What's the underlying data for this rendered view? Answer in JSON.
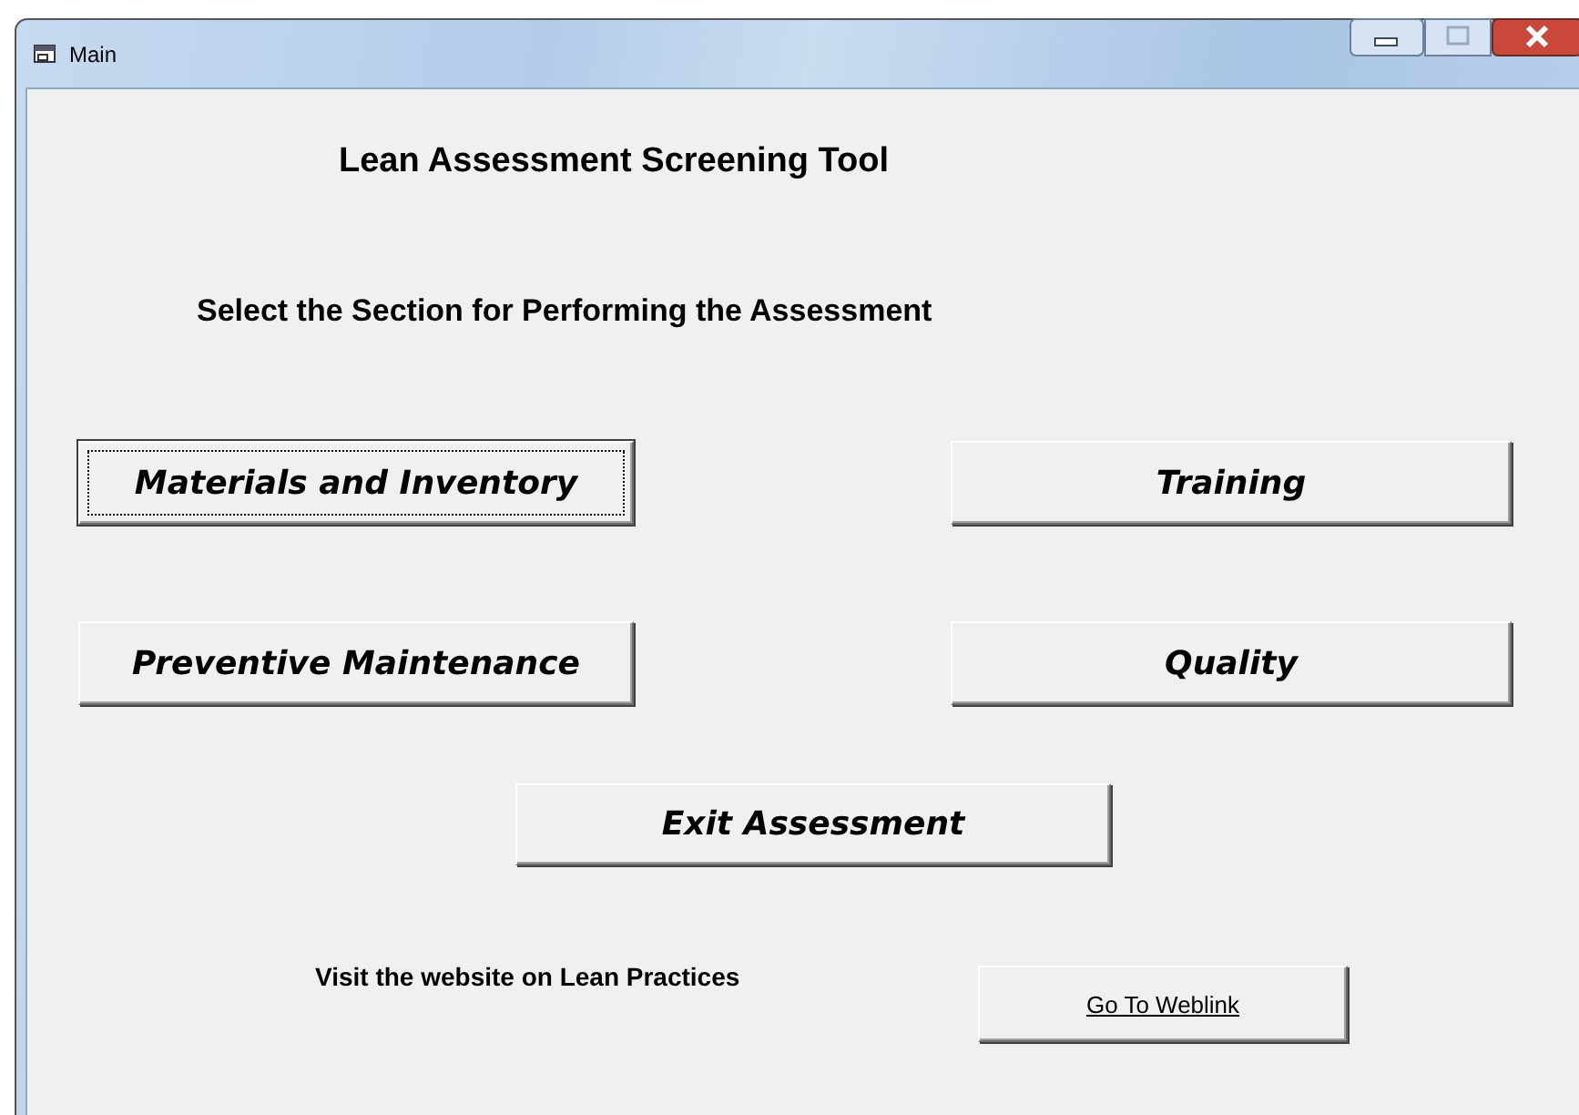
{
  "window": {
    "title": "Main"
  },
  "heading": "Lean Assessment Screening Tool",
  "instruction": "Select the Section for Performing the Assessment",
  "section_buttons": [
    {
      "label": "Materials and Inventory",
      "focused": true
    },
    {
      "label": "Training",
      "focused": false
    },
    {
      "label": "Preventive Maintenance",
      "focused": false
    },
    {
      "label": "Quality",
      "focused": false
    }
  ],
  "exit_button": {
    "label": "Exit Assessment",
    "focused": false
  },
  "weblink": {
    "caption": "Visit the website on Lean Practices",
    "button": "Go To Weblink"
  }
}
